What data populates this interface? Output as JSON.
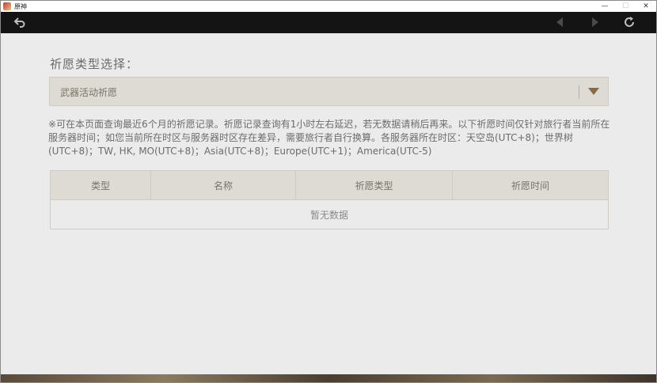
{
  "window": {
    "title": "原神",
    "controls": {
      "minimize": "—",
      "maximize": "☐",
      "close": "✕"
    }
  },
  "toolbar": {
    "icons": [
      "back-arrow-icon",
      "prev-icon",
      "next-icon",
      "refresh-icon"
    ],
    "colors": {
      "background": "#141414",
      "active_icon": "#bdbdbd",
      "disabled_icon": "#4a4a4a"
    }
  },
  "page": {
    "select_label": "祈愿类型选择：",
    "select_value": "武器活动祈愿",
    "notice": "※可在本页面查询最近6个月的祈愿记录。祈愿记录查询有1小时左右延迟，若无数据请稍后再来。以下祈愿时间仅针对旅行者当前所在服务器时间；如您当前所在时区与服务器时区存在差异，需要旅行者自行换算。各服务器所在时区：天空岛(UTC+8)；世界树(UTC+8)；TW, HK, MO(UTC+8)；Asia(UTC+8)；Europe(UTC+1)；America(UTC-5)",
    "table": {
      "headers": [
        "类型",
        "名称",
        "祈愿类型",
        "祈愿时间"
      ],
      "empty_text": "暂无数据"
    },
    "colors": {
      "background": "#ebebeb",
      "panel": "#dedbd5",
      "accent": "#8a6a44"
    }
  }
}
